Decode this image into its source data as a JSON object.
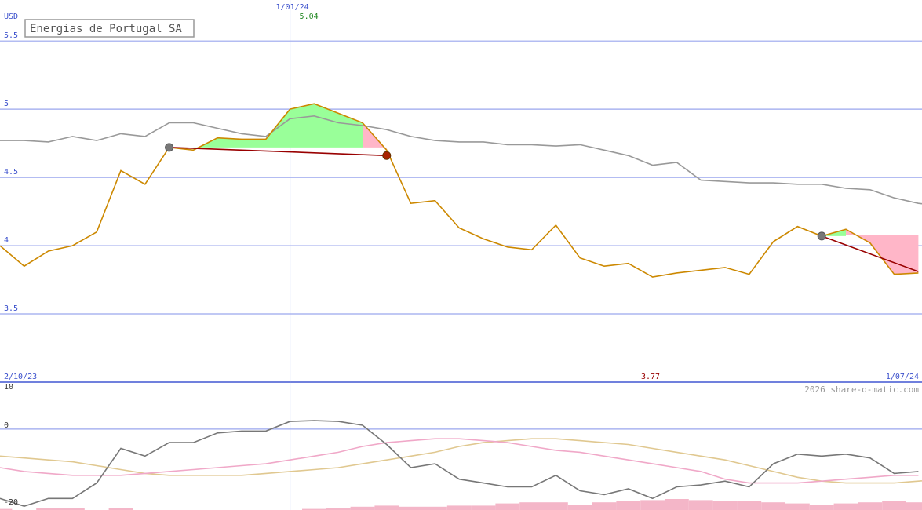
{
  "chart_data": [
    {
      "type": "line",
      "title": "Energias de Portugal SA",
      "unit_label": "USD",
      "x_start_label": "2/10/23",
      "x_end_label": "1/07/24",
      "marker": {
        "date_label": "1/01/24",
        "value_label": "5.04"
      },
      "last_value_label": "3.77",
      "watermark": "2026 share-o-matic.com",
      "ylim": [
        3.0,
        5.8
      ],
      "y_ticks": [
        3.5,
        4,
        4.5,
        5,
        5.5
      ],
      "y_tick_labels": [
        "3.5",
        "4",
        "4.5",
        "5",
        "5.5"
      ],
      "series": [
        {
          "color": "#cc8800",
          "values": [
            4.0,
            3.85,
            3.96,
            4.0,
            4.1,
            4.55,
            4.45,
            4.72,
            4.7,
            4.79,
            4.78,
            4.78,
            5.0,
            5.04,
            4.97,
            4.9,
            4.7,
            4.31,
            4.33,
            4.13,
            4.05,
            3.99,
            3.97,
            4.15,
            3.91,
            3.85,
            3.87,
            3.77,
            3.8,
            3.82,
            3.84,
            3.79,
            4.03,
            4.14,
            4.07,
            4.12,
            4.02,
            3.79,
            3.8
          ]
        },
        {
          "color": "#999999",
          "values": [
            4.77,
            4.77,
            4.76,
            4.8,
            4.77,
            4.82,
            4.8,
            4.9,
            4.9,
            4.86,
            4.82,
            4.8,
            4.93,
            4.95,
            4.9,
            4.88,
            4.85,
            4.8,
            4.77,
            4.76,
            4.76,
            4.74,
            4.74,
            4.73,
            4.74,
            4.7,
            4.66,
            4.59,
            4.61,
            4.48,
            4.47,
            4.46,
            4.46,
            4.45,
            4.45,
            4.42,
            4.41,
            4.35,
            4.31,
            4.29
          ]
        }
      ],
      "trend_segments": [
        {
          "from": [
            7,
            4.72
          ],
          "to": [
            16,
            4.66
          ]
        },
        {
          "from": [
            34,
            4.07
          ],
          "to": [
            38,
            3.81
          ]
        }
      ],
      "gain_regions": [
        {
          "x_from": 8,
          "x_to": 15,
          "base": 4.72
        },
        {
          "x_from": 34,
          "x_to": 35,
          "base": 4.07
        }
      ],
      "loss_regions": [
        {
          "x_from": 15,
          "x_to": 16,
          "top": 4.72
        },
        {
          "x_from": 35,
          "x_to": 38,
          "top": 4.08
        }
      ]
    },
    {
      "type": "line",
      "ylim": [
        -21,
        12
      ],
      "y_ticks": [
        -20,
        0,
        10
      ],
      "y_tick_labels": [
        "-20",
        "0",
        "10"
      ],
      "series": [
        {
          "color": "#777777",
          "values": [
            -18,
            -20,
            -18,
            -18,
            -14,
            -5,
            -7,
            -3.5,
            -3.5,
            -1,
            -0.5,
            -0.5,
            2,
            2.2,
            2,
            1,
            -4,
            -10,
            -9,
            -13,
            -14,
            -15,
            -15,
            -12,
            -16,
            -17,
            -15.5,
            -18,
            -15,
            -14.5,
            -13.5,
            -15,
            -9,
            -6.5,
            -7,
            -6.5,
            -7.5,
            -11.5,
            -11
          ]
        },
        {
          "color": "#f0a8c8",
          "values": [
            -10,
            -11,
            -11.5,
            -12,
            -12,
            -12,
            -11.5,
            -11,
            -10.5,
            -10,
            -9.5,
            -9,
            -8,
            -7,
            -6,
            -4.5,
            -3.5,
            -3,
            -2.5,
            -2.5,
            -3,
            -3.5,
            -4.5,
            -5.5,
            -6,
            -7,
            -8,
            -9,
            -10,
            -11,
            -13,
            -14,
            -14,
            -14,
            -13.5,
            -13,
            -12.5,
            -12,
            -12
          ]
        },
        {
          "color": "#e0c890",
          "values": [
            -7,
            -7.5,
            -8,
            -8.5,
            -9.5,
            -10.5,
            -11.5,
            -12,
            -12,
            -12,
            -12,
            -11.5,
            -11,
            -10.5,
            -10,
            -9,
            -8,
            -7,
            -6,
            -4.5,
            -3.5,
            -3,
            -2.5,
            -2.5,
            -3,
            -3.5,
            -4,
            -5,
            -6,
            -7,
            -8,
            -9.5,
            -11,
            -12.5,
            -13.5,
            -14,
            -14,
            -14,
            -13.5,
            -13
          ]
        }
      ],
      "volume": [
        1,
        0,
        2,
        2,
        0,
        2,
        0,
        0,
        0,
        0,
        0,
        0,
        0,
        1,
        2,
        3,
        4,
        3,
        3,
        4,
        4,
        6,
        7,
        7,
        5,
        7,
        8,
        9,
        10,
        9,
        8,
        8,
        7,
        6,
        5,
        6,
        7,
        8,
        7,
        6
      ],
      "volume_color": "#f4b6c8"
    }
  ]
}
